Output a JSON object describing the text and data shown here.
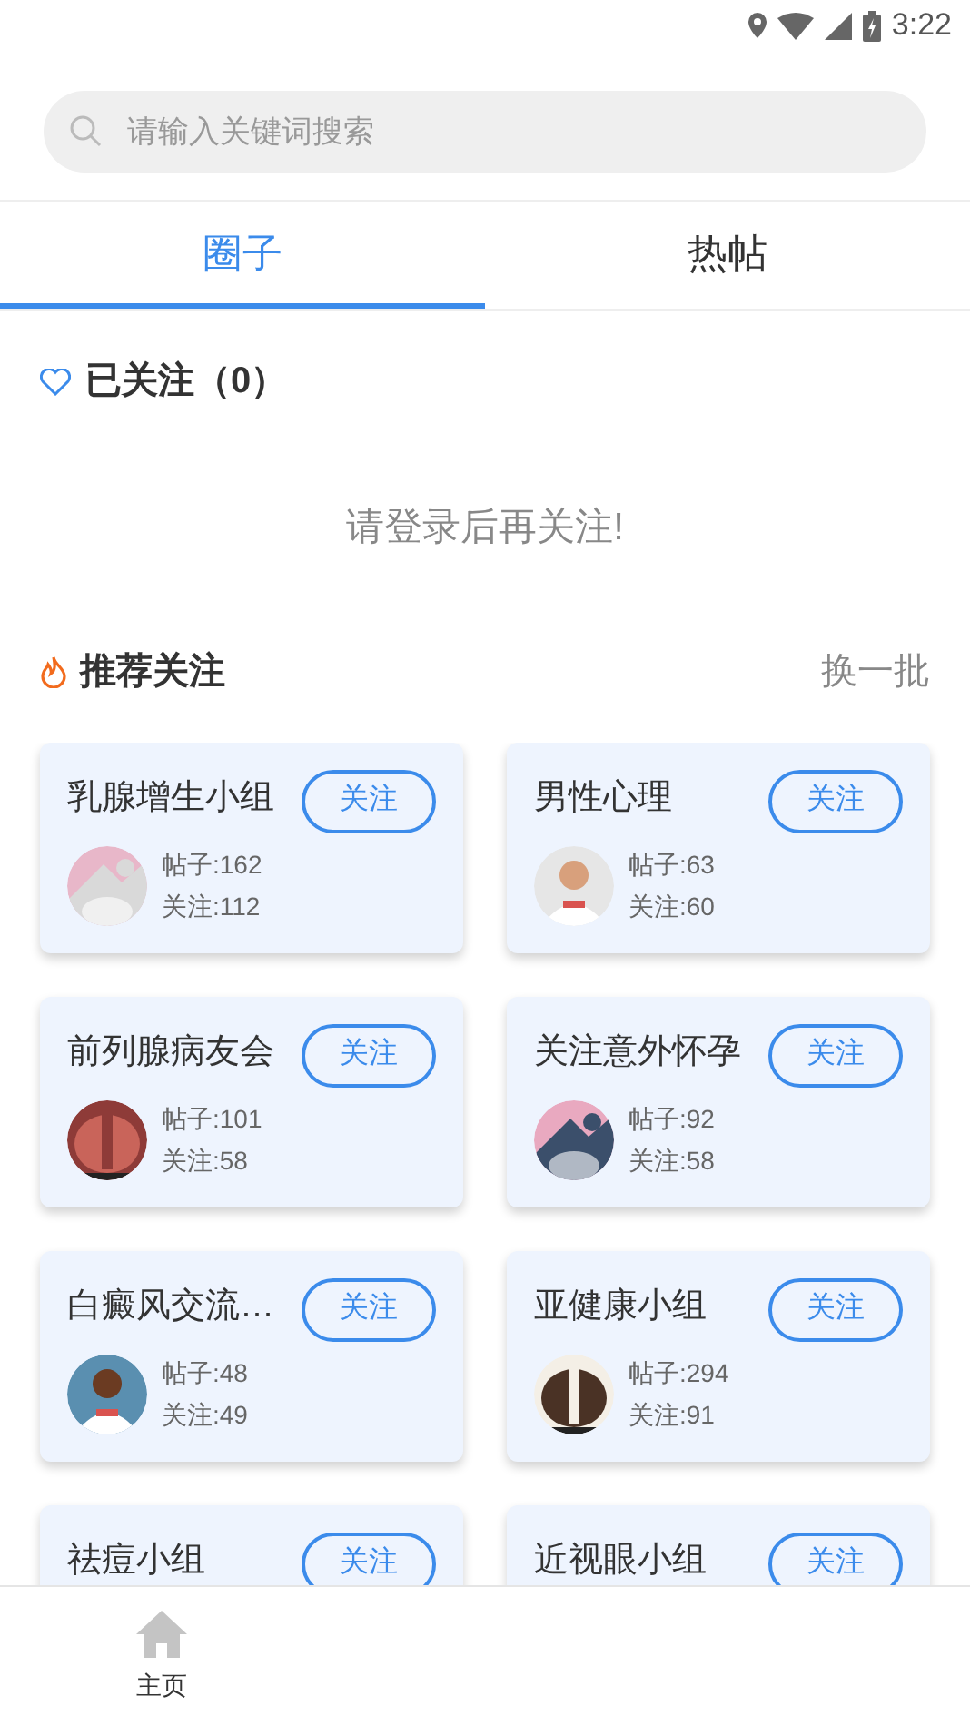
{
  "status_bar": {
    "time": "3:22"
  },
  "search": {
    "placeholder": "请输入关键词搜索"
  },
  "tabs": [
    {
      "label": "圈子",
      "selected": true
    },
    {
      "label": "热帖",
      "selected": false
    }
  ],
  "followed": {
    "title": "已关注（0）",
    "empty_message": "请登录后再关注!"
  },
  "recommended": {
    "title": "推荐关注",
    "refresh": "换一批",
    "groups": [
      {
        "name": "乳腺增生小组",
        "button": "关注",
        "posts": "帖子:162",
        "followers": "关注:112"
      },
      {
        "name": "男性心理",
        "button": "关注",
        "posts": "帖子:63",
        "followers": "关注:60"
      },
      {
        "name": "前列腺病友会",
        "button": "关注",
        "posts": "帖子:101",
        "followers": "关注:58"
      },
      {
        "name": "关注意外怀孕",
        "button": "关注",
        "posts": "帖子:92",
        "followers": "关注:58"
      },
      {
        "name": "白癜风交流…",
        "button": "关注",
        "posts": "帖子:48",
        "followers": "关注:49"
      },
      {
        "name": "亚健康小组",
        "button": "关注",
        "posts": "帖子:294",
        "followers": "关注:91"
      },
      {
        "name": "祛痘小组",
        "button": "关注"
      },
      {
        "name": "近视眼小组",
        "button": "关注"
      }
    ]
  },
  "bottom_nav": [
    {
      "label": "主页",
      "selected": false
    }
  ]
}
